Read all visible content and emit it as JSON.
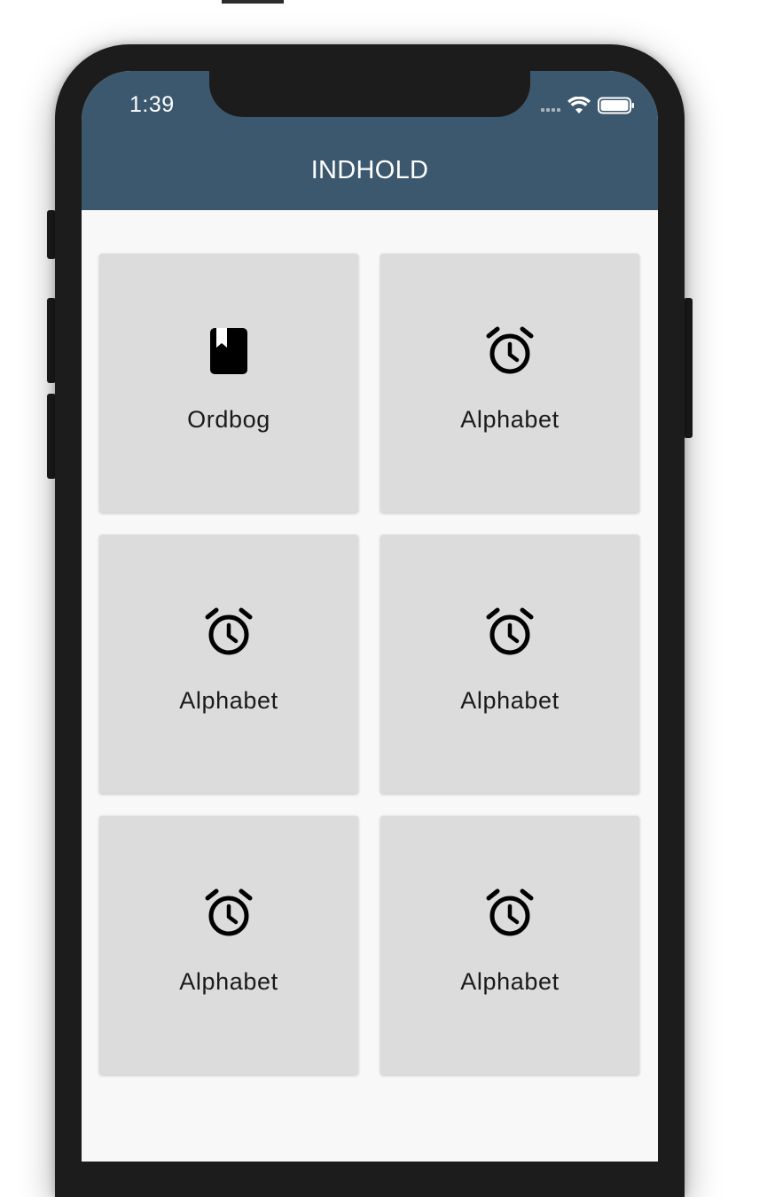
{
  "status_bar": {
    "time": "1:39"
  },
  "app_bar": {
    "title": "INDHOLD"
  },
  "tiles": [
    {
      "label": "Ordbog",
      "icon": "book-icon"
    },
    {
      "label": "Alphabet",
      "icon": "alarm-clock-icon"
    },
    {
      "label": "Alphabet",
      "icon": "alarm-clock-icon"
    },
    {
      "label": "Alphabet",
      "icon": "alarm-clock-icon"
    },
    {
      "label": "Alphabet",
      "icon": "alarm-clock-icon"
    },
    {
      "label": "Alphabet",
      "icon": "alarm-clock-icon"
    }
  ],
  "colors": {
    "app_bar": "#3c586e",
    "tile_background": "#dcdcdc",
    "screen_background": "#f8f8f8",
    "device_frame": "#1c1c1c"
  }
}
